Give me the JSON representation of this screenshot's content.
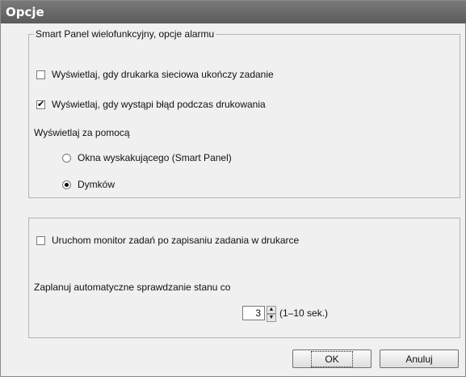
{
  "window": {
    "title": "Opcje"
  },
  "alarm_group": {
    "legend": "Smart Panel wielofunkcyjny, opcje alarmu",
    "notify_network_print_done": {
      "label": "Wyświetlaj, gdy drukarka sieciowa ukończy zadanie",
      "checked": false
    },
    "notify_print_error": {
      "label": "Wyświetlaj, gdy wystąpi błąd podczas drukowania",
      "checked": true
    },
    "display_via_label": "Wyświetlaj za pomocą",
    "options": [
      {
        "label": "Okna wyskakującego (Smart Panel)",
        "selected": false
      },
      {
        "label": "Dymków",
        "selected": true
      }
    ]
  },
  "job_group": {
    "start_monitor": {
      "label": "Uruchom monitor zadań po zapisaniu zadania w drukarce",
      "checked": false
    },
    "schedule_label": "Zaplanuj automatyczne sprawdzanie stanu co",
    "interval_value": "3",
    "interval_range": "(1–10 sek.)"
  },
  "buttons": {
    "ok": "OK",
    "cancel": "Anuluj"
  }
}
